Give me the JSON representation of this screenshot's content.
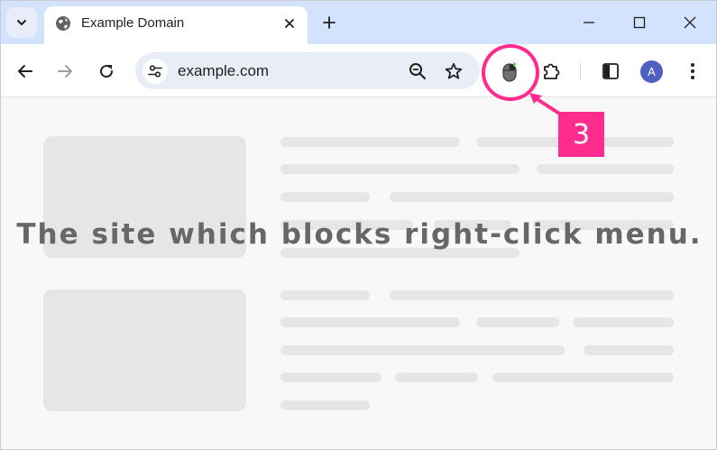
{
  "tabstrip": {
    "tab": {
      "title": "Example Domain",
      "favicon": "globe-icon",
      "close_icon": "close-icon"
    },
    "search_tabs_icon": "chevron-down-icon",
    "new_tab_icon": "plus-icon",
    "window_controls": [
      "minimize-icon",
      "maximize-icon",
      "close-icon"
    ]
  },
  "toolbar": {
    "back_icon": "arrow-left-icon",
    "forward_icon": "arrow-right-icon",
    "reload_icon": "reload-icon",
    "site_info_icon": "tune-icon",
    "url": "example.com",
    "zoom_icon": "zoom-out-icon",
    "bookmark_icon": "star-icon",
    "extension_icon": "mouse-icon",
    "extensions_menu_icon": "puzzle-icon",
    "side_panel_icon": "side-panel-icon",
    "profile_initial": "A",
    "menu_icon": "more-vert-icon"
  },
  "page": {
    "caption": "The site which blocks right-click menu."
  },
  "annotation": {
    "step_number": "3",
    "color": "#ff2b8e"
  },
  "colors": {
    "tabstrip_bg": "#d3e3fd",
    "omnibox_bg": "#e9eef6",
    "avatar_bg": "#4f5fc0",
    "skeleton": "#e6e6e6"
  }
}
